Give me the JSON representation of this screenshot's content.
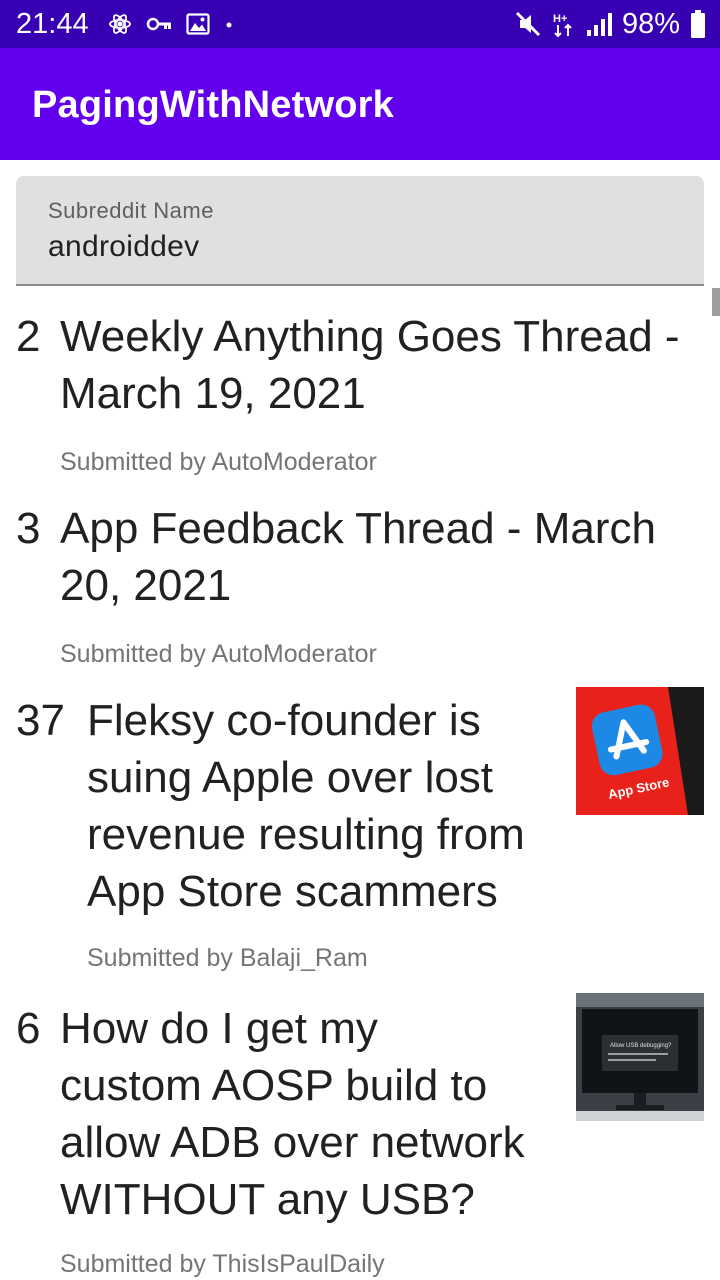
{
  "status_bar": {
    "time": "21:44",
    "battery_percent": "98%",
    "left_icons": [
      "atom-icon",
      "key-icon",
      "image-icon",
      "dot-icon"
    ],
    "right_icons": [
      "mute-icon",
      "data-arrows-icon",
      "signal-icon",
      "battery-icon"
    ]
  },
  "app_bar": {
    "title": "PagingWithNetwork"
  },
  "subreddit_field": {
    "label": "Subreddit Name",
    "value": "androiddev"
  },
  "posts": [
    {
      "score": "2",
      "title_lines": [
        "Weekly Anything Goes Thread -",
        "March 19, 2021"
      ],
      "author": "Submitted by AutoModerator",
      "has_thumbnail": false
    },
    {
      "score": "3",
      "title_lines": [
        "App Feedback Thread - March",
        "20, 2021"
      ],
      "author": "Submitted by AutoModerator",
      "has_thumbnail": false
    },
    {
      "score": "37",
      "title_lines": [
        "Fleksy co-founder is",
        "suing Apple over lost",
        "revenue resulting from",
        "App Store scammers"
      ],
      "author": "Submitted by Balaji_Ram",
      "has_thumbnail": true,
      "thumbnail_text": "App Store"
    },
    {
      "score": "6",
      "title_lines": [
        "How do I get my",
        "custom AOSP build to",
        "allow ADB over network",
        "WITHOUT any USB?"
      ],
      "author": "Submitted by ThisIsPaulDaily",
      "has_thumbnail": true,
      "thumbnail_text": "Allow USB debugging?"
    }
  ],
  "colors": {
    "status_bar": "#3700b3",
    "app_bar": "#6200ee",
    "field_bg": "#e0e0e0",
    "secondary_text": "#757575",
    "app_store_red": "#e8221b",
    "app_store_blue": "#1e88e5"
  }
}
